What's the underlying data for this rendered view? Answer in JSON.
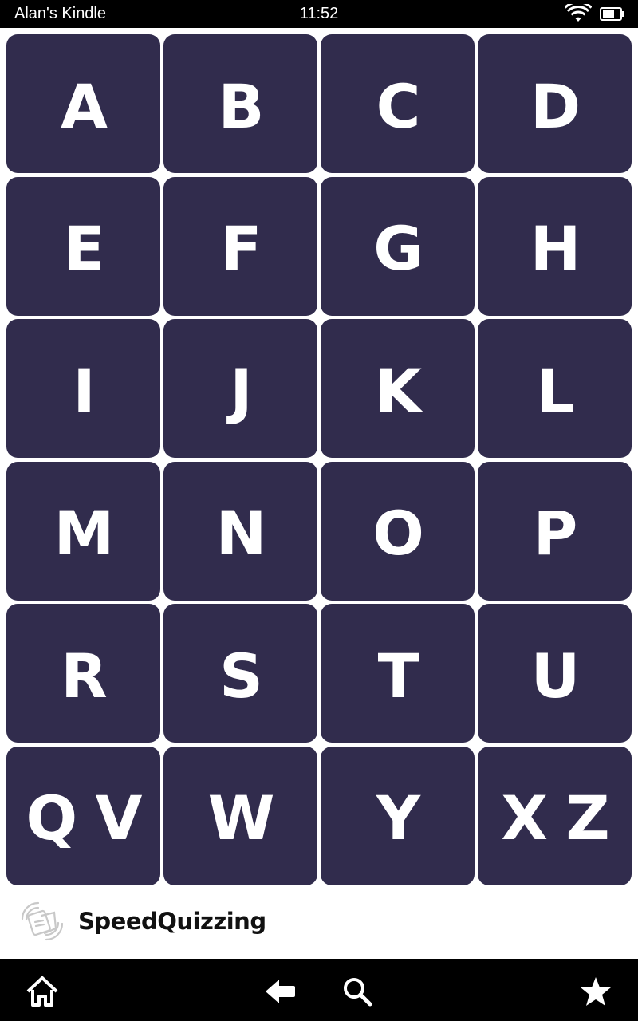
{
  "status_bar": {
    "device_name": "Alan's Kindle",
    "time": "11:52",
    "icons": [
      "wifi-icon",
      "battery-icon"
    ]
  },
  "letter_grid": {
    "keys": [
      "A",
      "B",
      "C",
      "D",
      "E",
      "F",
      "G",
      "H",
      "I",
      "J",
      "K",
      "L",
      "M",
      "N",
      "O",
      "P",
      "R",
      "S",
      "T",
      "U",
      "Q V",
      "W",
      "Y",
      "X Z"
    ]
  },
  "footer": {
    "brand": "SpeedQuizzing",
    "logo_icon": "speedquizzing-logo-icon"
  },
  "nav_bar": {
    "icons": [
      "home-icon",
      "back-arrow-icon",
      "search-icon",
      "star-icon"
    ]
  },
  "colors": {
    "key_background": "#312c4d",
    "key_text": "#ffffff",
    "bars": "#000000"
  }
}
